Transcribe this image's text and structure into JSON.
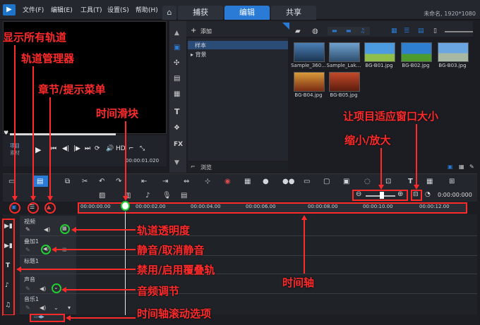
{
  "menu": {
    "file": "文件(F)",
    "edit": "编辑(E)",
    "tools": "工具(T)",
    "settings": "设置(S)",
    "help": "帮助(H)"
  },
  "tabs": [
    "捕获",
    "编辑",
    "共享"
  ],
  "project_info": "未命名, 1920*1080",
  "library": {
    "add_label": "添加",
    "tree": [
      "样本",
      "背景"
    ],
    "thumbnails": [
      "Sample_360...",
      "Sample_Lak...",
      "BG-B01.jpg",
      "BG-B02.jpg",
      "BG-B03.jpg",
      "BG-B04.jpg",
      "BG-B05.jpg"
    ],
    "browse": "浏览"
  },
  "preview": {
    "project_label": "项目",
    "clip_label": "素材",
    "hd": "HD",
    "timecode": "00:00:01.020"
  },
  "timeline": {
    "ticks": [
      "00:00:00.00",
      "00:00:02.00",
      "00:00:04.00",
      "00:00:06.00",
      "00:00:08.00",
      "00:00:10.00",
      "00:00:12.00"
    ],
    "timecode": "0:00:00:000",
    "tracks": [
      "视频",
      "叠加1",
      "标题1",
      "声音",
      "音乐1"
    ]
  },
  "annotations": {
    "show_all_tracks": "显示所有轨道",
    "track_manager": "轨道管理器",
    "chapter_menu": "章节/提示菜单",
    "time_slider": "时间滑块",
    "fit_window": "让项目适应窗口大小",
    "zoom": "缩小/放大",
    "track_opacity": "轨道透明度",
    "mute": "静音/取消静音",
    "overlay_toggle": "禁用/启用覆叠轨",
    "audio_adjust": "音频调节",
    "timeline": "时间轴",
    "scroll_option": "时间轴滚动选项"
  },
  "colors": {
    "annotation": "#ff2b2b",
    "highlight_green": "#22cc33",
    "accent_blue": "#2a7bd6"
  }
}
